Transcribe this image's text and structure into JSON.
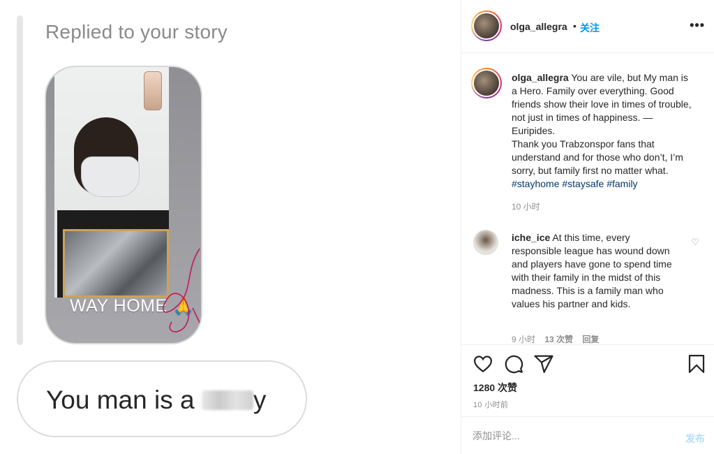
{
  "story_reply": {
    "replied_label": "Replied to your story",
    "story_overlay_text": "WAY HOME 🙏",
    "message_visible": "You man is a ",
    "message_tail": "y"
  },
  "post": {
    "header": {
      "username": "olga_allegra",
      "separator": "•",
      "follow_label": "关注",
      "more_icon": "more-horizontal-icon"
    },
    "caption": {
      "username": "olga_allegra",
      "text_lines": [
        "You are vile, but My man is a Hero. Family over everything.",
        "Good friends show their love in times of trouble, not just in times of happiness. — Euripides.",
        "Thank you Trabzonspor fans that understand and for those who don’t, I’m sorry, but family first no matter what."
      ],
      "hashtags": [
        "#stayhome",
        "#staysafe",
        "#family"
      ],
      "time": "10 小时"
    },
    "comments": [
      {
        "username": "iche_ice",
        "text": "At this time, every responsible league has wound down and players have gone to spend time with their family in the midst of this madness. This is a family man who values his partner and kids.",
        "time": "9 小时",
        "likes": "13 次赞",
        "reply_label": "回复"
      }
    ],
    "actions": {
      "icons": [
        "heart-icon",
        "comment-icon",
        "share-icon",
        "bookmark-icon"
      ],
      "likes_label": "1280 次赞",
      "post_time": "10 小时前"
    },
    "composer": {
      "placeholder": "添加评论...",
      "post_label": "发布"
    }
  },
  "colors": {
    "accent": "#0095f6",
    "hashtag": "#00376b",
    "muted": "#8e8e8e",
    "post_disabled": "#b2dffc"
  }
}
